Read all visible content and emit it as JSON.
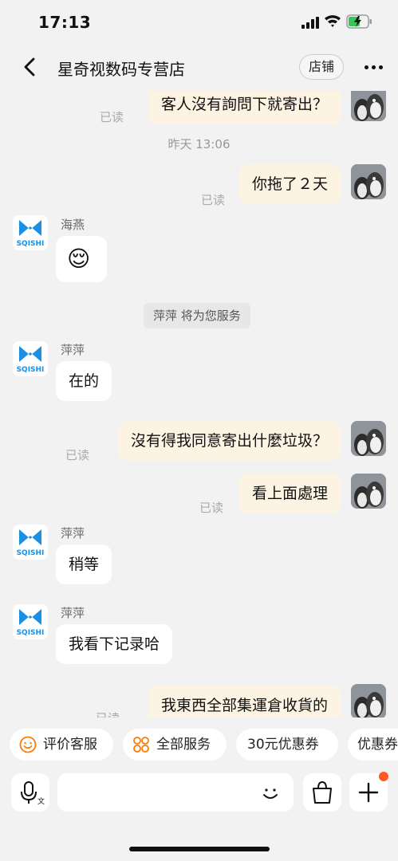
{
  "status": {
    "time": "17:13"
  },
  "nav": {
    "title": "星奇视数码专营店",
    "store_label": "店铺"
  },
  "chat": {
    "read_label": "已读",
    "time_divider": "昨天 13:06",
    "system_notice": "萍萍 将为您服务",
    "messages": {
      "out1": "客人沒有詢問下就寄出？",
      "out2": "你拖了２天",
      "out3": "沒有得我同意寄出什麼垃圾？",
      "out4": "看上面處理",
      "out5": "我東西全部集運倉收貨的",
      "in2": "在的",
      "in3": "稍等",
      "in4": "我看下记录哈"
    },
    "senders": {
      "haiyan": "海燕",
      "pingping": "萍萍"
    },
    "emoji": "😌",
    "logo_text": "SQISHI"
  },
  "quick_actions": [
    {
      "label": "评价客服",
      "icon": "smile-icon"
    },
    {
      "label": "全部服务",
      "icon": "grid-icon"
    },
    {
      "label": "30元优惠券"
    },
    {
      "label": "优惠券"
    }
  ],
  "input": {
    "placeholder": ""
  },
  "colors": {
    "accent": "#ff7a00",
    "bubble_out": "#fdf3e3",
    "bubble_in": "#ffffff",
    "logo_blue": "#1a8fe3"
  }
}
